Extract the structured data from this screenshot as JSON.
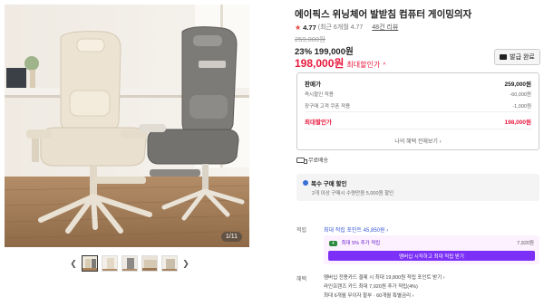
{
  "gallery": {
    "counter": "1/11",
    "thumb_count": 5,
    "prev_arrow": "chevron-left-icon",
    "next_arrow": "chevron-right-icon"
  },
  "product": {
    "title": "에이픽스 위닝체어 발받침 컴퓨터 게이밍의자",
    "rating_score": "4.77",
    "rating_note": "(최근 6개월 4.77",
    "review_link": "48건 리뷰",
    "original_price": "259,000원",
    "discount_line": "23% 199,000원",
    "max_price": "198,000원",
    "max_label": "최대할인가",
    "coupon_button": "발급 완료"
  },
  "price_box": {
    "head_label": "판매가",
    "head_value": "259,000원",
    "rows": [
      {
        "label": "즉시할인 적용",
        "value": "-60,000원"
      },
      {
        "label": "장구매 고객 쿠폰 적용",
        "value": "-1,000원"
      }
    ],
    "total_label": "최대할인가",
    "total_value": "198,000원",
    "more_link": "나의 혜택 전체보기"
  },
  "shipping": {
    "label": "무료배송"
  },
  "multi_buy": {
    "title": "복수 구매 할인",
    "subtitle": "2개 이상 구매시 수량만큼 5,000원 할인"
  },
  "points": {
    "label": "적립",
    "title": "최대 적립 포인트 45,850원",
    "plus_badge": "+",
    "plus_text": "최대 5% 추가 적립",
    "plus_amount": "7,920원",
    "plus_button": "멤버십 시작하고 최대 적립 받기"
  },
  "benefits": {
    "label": "혜택",
    "lines": [
      "멤버십 전용카드 결제 시 최대 19,800원 적립 포인트 받기",
      "라인프렌즈 카드 최대 7,920원 추가 적립(4%)",
      "최대 6개월 무이자 할부 · 60개월 특별금리"
    ]
  },
  "colors": {
    "accent_red": "#e8183c",
    "plus_purple": "#7b2ff7",
    "link_blue": "#3b58d4"
  }
}
